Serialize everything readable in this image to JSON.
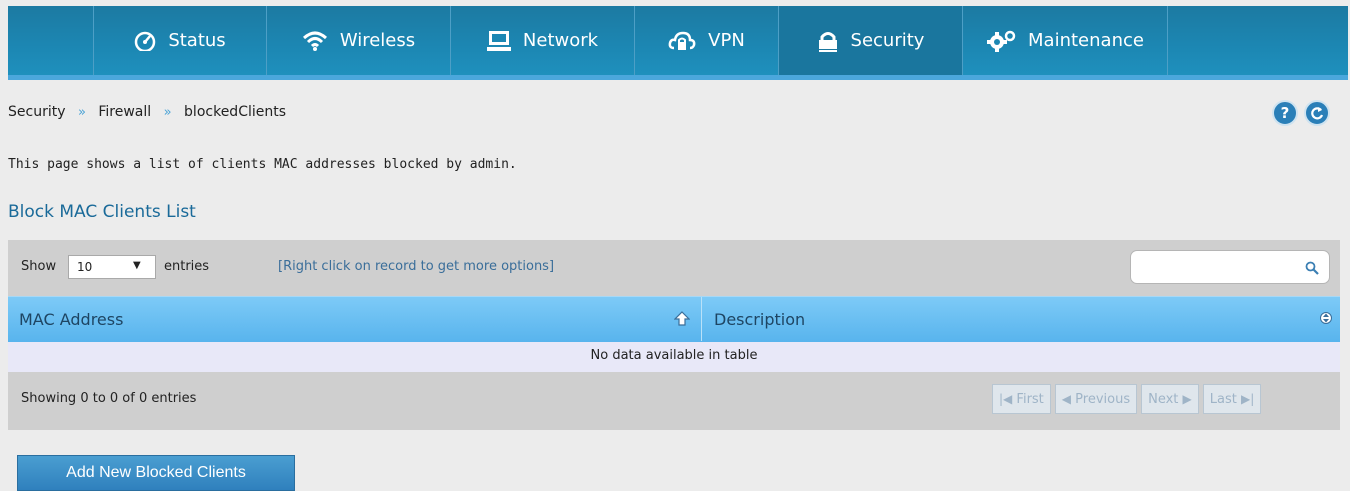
{
  "nav": {
    "items": [
      {
        "label": "Status",
        "icon": "gauge-icon"
      },
      {
        "label": "Wireless",
        "icon": "wifi-icon"
      },
      {
        "label": "Network",
        "icon": "monitor-icon"
      },
      {
        "label": "VPN",
        "icon": "cloud-lock-icon"
      },
      {
        "label": "Security",
        "icon": "lock-icon",
        "active": true
      },
      {
        "label": "Maintenance",
        "icon": "gears-icon"
      }
    ]
  },
  "breadcrumb": {
    "items": [
      "Security",
      "Firewall",
      "blockedClients"
    ],
    "separator": "»"
  },
  "header_buttons": {
    "help": "?",
    "refresh": "refresh-icon"
  },
  "description": "This page shows a list of clients MAC addresses blocked by admin.",
  "section_title": "Block MAC Clients List",
  "table": {
    "show_label": "Show",
    "entries_value": "10",
    "entries_label": "entries",
    "hint": "[Right click on record to get more options]",
    "search_placeholder": "",
    "columns": [
      "MAC Address",
      "Description"
    ],
    "empty_message": "No data available in table",
    "info": "Showing 0 to 0 of 0 entries",
    "pager": {
      "first": "First",
      "previous": "Previous",
      "next": "Next",
      "last": "Last"
    }
  },
  "add_button": "Add New Blocked Clients",
  "colors": {
    "nav": "#1c87b3",
    "accent": "#4ba7dc",
    "header_row": "#69bef3",
    "button": "#3a8fc8"
  }
}
